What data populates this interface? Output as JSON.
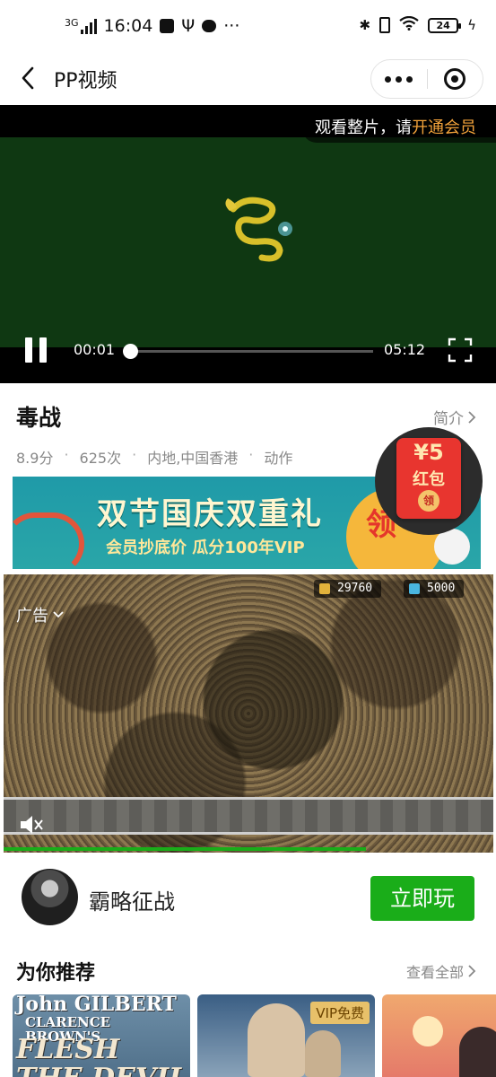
{
  "status_bar": {
    "network": "3G",
    "time": "16:04",
    "battery": "24"
  },
  "title_bar": {
    "title": "PP视频"
  },
  "player": {
    "vip_prompt": "观看整片，请",
    "vip_link": "开通会员",
    "current_time": "00:01",
    "duration": "05:12",
    "progress": 0.003
  },
  "movie": {
    "title": "毒战",
    "intro_link": "简介",
    "score": "8.9分",
    "plays": "625次",
    "region": "内地,中国香港",
    "genre": "动作"
  },
  "red_envelope": {
    "amount": "¥5",
    "label": "红包",
    "seal": "领"
  },
  "promo": {
    "title": "双节国庆双重礼",
    "subtitle": "会员抄底价  瓜分100年VIP",
    "cta": "领"
  },
  "ad": {
    "label": "广告",
    "hud_coins": "29760",
    "hud_gems": "5000",
    "progress": 0.74,
    "game_name": "霸略征战",
    "play_label": "立即玩"
  },
  "recommend": {
    "title": "为你推荐",
    "see_all": "查看全部",
    "cards": [
      {
        "poster_text_1": "John GILBERT",
        "poster_text_2": "CLARENCE BROWN'S",
        "poster_text_3": "FLESH THE DEVIL"
      },
      {
        "badge": "VIP免费"
      },
      {}
    ]
  },
  "colors": {
    "accent_green": "#1aad19",
    "vip_orange": "#f2a23a",
    "video_bg": "#0f3812",
    "red_envelope": "#e8352f"
  }
}
